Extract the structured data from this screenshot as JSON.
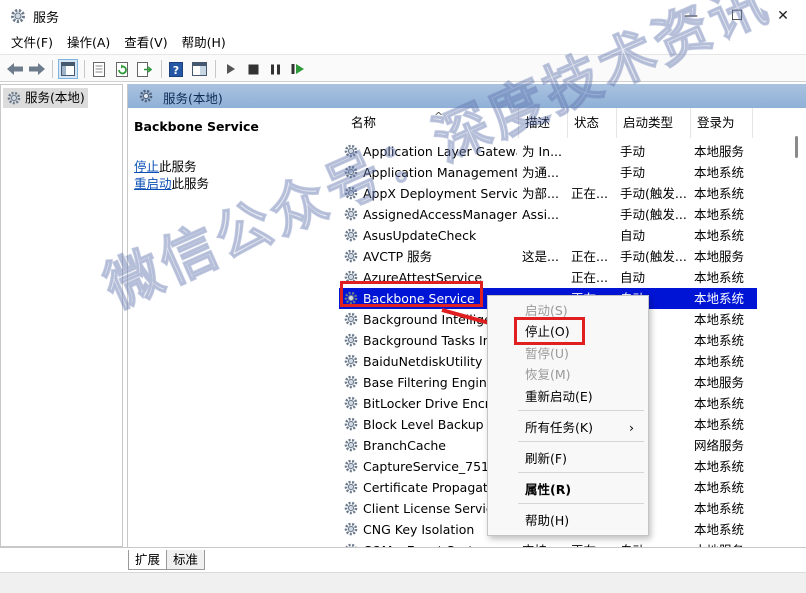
{
  "window": {
    "title": "服务",
    "minimize": "—",
    "maximize": "☐",
    "close": "✕"
  },
  "menubar": [
    {
      "label": "文件(F)"
    },
    {
      "label": "操作(A)"
    },
    {
      "label": "查看(V)"
    },
    {
      "label": "帮助(H)"
    }
  ],
  "toolbar_icons": [
    "back-arrow-icon",
    "forward-arrow-icon",
    "console-tree-icon",
    "properties-icon",
    "refresh-icon",
    "export-list-icon",
    "help-icon",
    "show-hide-icon",
    "start-service-icon",
    "stop-service-icon",
    "pause-service-icon",
    "restart-service-icon"
  ],
  "tree": {
    "item": "服务(本地)"
  },
  "pane": {
    "header": "服务(本地)"
  },
  "description": {
    "service_name": "Backbone Service",
    "stop_link": "停止",
    "stop_suffix": "此服务",
    "restart_link": "重启动",
    "restart_suffix": "此服务"
  },
  "columns": [
    "名称",
    "描述",
    "状态",
    "启动类型",
    "登录为"
  ],
  "services": [
    {
      "name": "Application Layer Gatewa...",
      "desc": "为 In...",
      "status": "",
      "startup": "手动",
      "logon": "本地服务"
    },
    {
      "name": "Application Management",
      "desc": "为通...",
      "status": "",
      "startup": "手动",
      "logon": "本地系统"
    },
    {
      "name": "AppX Deployment Servic...",
      "desc": "为部...",
      "status": "正在...",
      "startup": "手动(触发...",
      "logon": "本地系统"
    },
    {
      "name": "AssignedAccessManager...",
      "desc": "Assi...",
      "status": "",
      "startup": "手动(触发...",
      "logon": "本地系统"
    },
    {
      "name": "AsusUpdateCheck",
      "desc": "",
      "status": "",
      "startup": "自动",
      "logon": "本地系统"
    },
    {
      "name": "AVCTP 服务",
      "desc": "这是...",
      "status": "正在...",
      "startup": "手动(触发...",
      "logon": "本地服务"
    },
    {
      "name": "AzureAttestService",
      "desc": "",
      "status": "正在...",
      "startup": "自动",
      "logon": "本地系统"
    },
    {
      "name": "Backbone Service",
      "desc": "",
      "status": "正在...",
      "startup": "自动",
      "logon": "本地系统"
    },
    {
      "name": "Background Intelliger",
      "desc": "",
      "status": "",
      "startup": "",
      "logon": "本地系统"
    },
    {
      "name": "Background Tasks Inf",
      "desc": "",
      "status": "",
      "startup": "",
      "logon": "本地系统"
    },
    {
      "name": "BaiduNetdiskUtility",
      "desc": "",
      "status": "",
      "startup": "",
      "logon": "本地系统"
    },
    {
      "name": "Base Filtering Engine",
      "desc": "",
      "status": "",
      "startup": "",
      "logon": "本地服务"
    },
    {
      "name": "BitLocker Drive Encryp",
      "desc": "",
      "status": "",
      "startup": "...",
      "logon": "本地系统"
    },
    {
      "name": "Block Level Backup En",
      "desc": "",
      "status": "",
      "startup": "",
      "logon": "本地系统"
    },
    {
      "name": "BranchCache",
      "desc": "",
      "status": "",
      "startup": "",
      "logon": "网络服务"
    },
    {
      "name": "CaptureService_7517f",
      "desc": "",
      "status": "",
      "startup": "",
      "logon": "本地系统"
    },
    {
      "name": "Certificate Propagatic",
      "desc": "",
      "status": "",
      "startup": "...",
      "logon": "本地系统"
    },
    {
      "name": "Client License Service",
      "desc": "",
      "status": "",
      "startup": "...",
      "logon": "本地系统"
    },
    {
      "name": "CNG Key Isolation",
      "desc": "",
      "status": "",
      "startup": "...",
      "logon": "本地系统"
    },
    {
      "name": "COM+ Event System",
      "desc": "支持...",
      "status": "正在...",
      "startup": "自动",
      "logon": "本地服务"
    }
  ],
  "selected_row_index": 7,
  "context_menu": [
    {
      "label": "启动(S)",
      "disabled": true
    },
    {
      "label": "停止(O)",
      "disabled": false
    },
    {
      "label": "暂停(U)",
      "disabled": true
    },
    {
      "label": "恢复(M)",
      "disabled": true
    },
    {
      "label": "重新启动(E)",
      "disabled": false
    },
    {
      "label": "所有任务(K)",
      "disabled": false,
      "submenu": "›"
    },
    {
      "label": "刷新(F)",
      "disabled": false
    },
    {
      "label": "属性(R)",
      "disabled": false,
      "bold": true
    },
    {
      "label": "帮助(H)",
      "disabled": false
    }
  ],
  "tabs": [
    {
      "label": "扩展",
      "active": true
    },
    {
      "label": "标准",
      "active": false
    }
  ],
  "watermark": "微信公众号：深度技术资讯",
  "colors": {
    "selected_row": "#0014d6",
    "highlight": "#e02020",
    "pane_header": "#a9c2e0",
    "link": "#0a4fb5"
  }
}
